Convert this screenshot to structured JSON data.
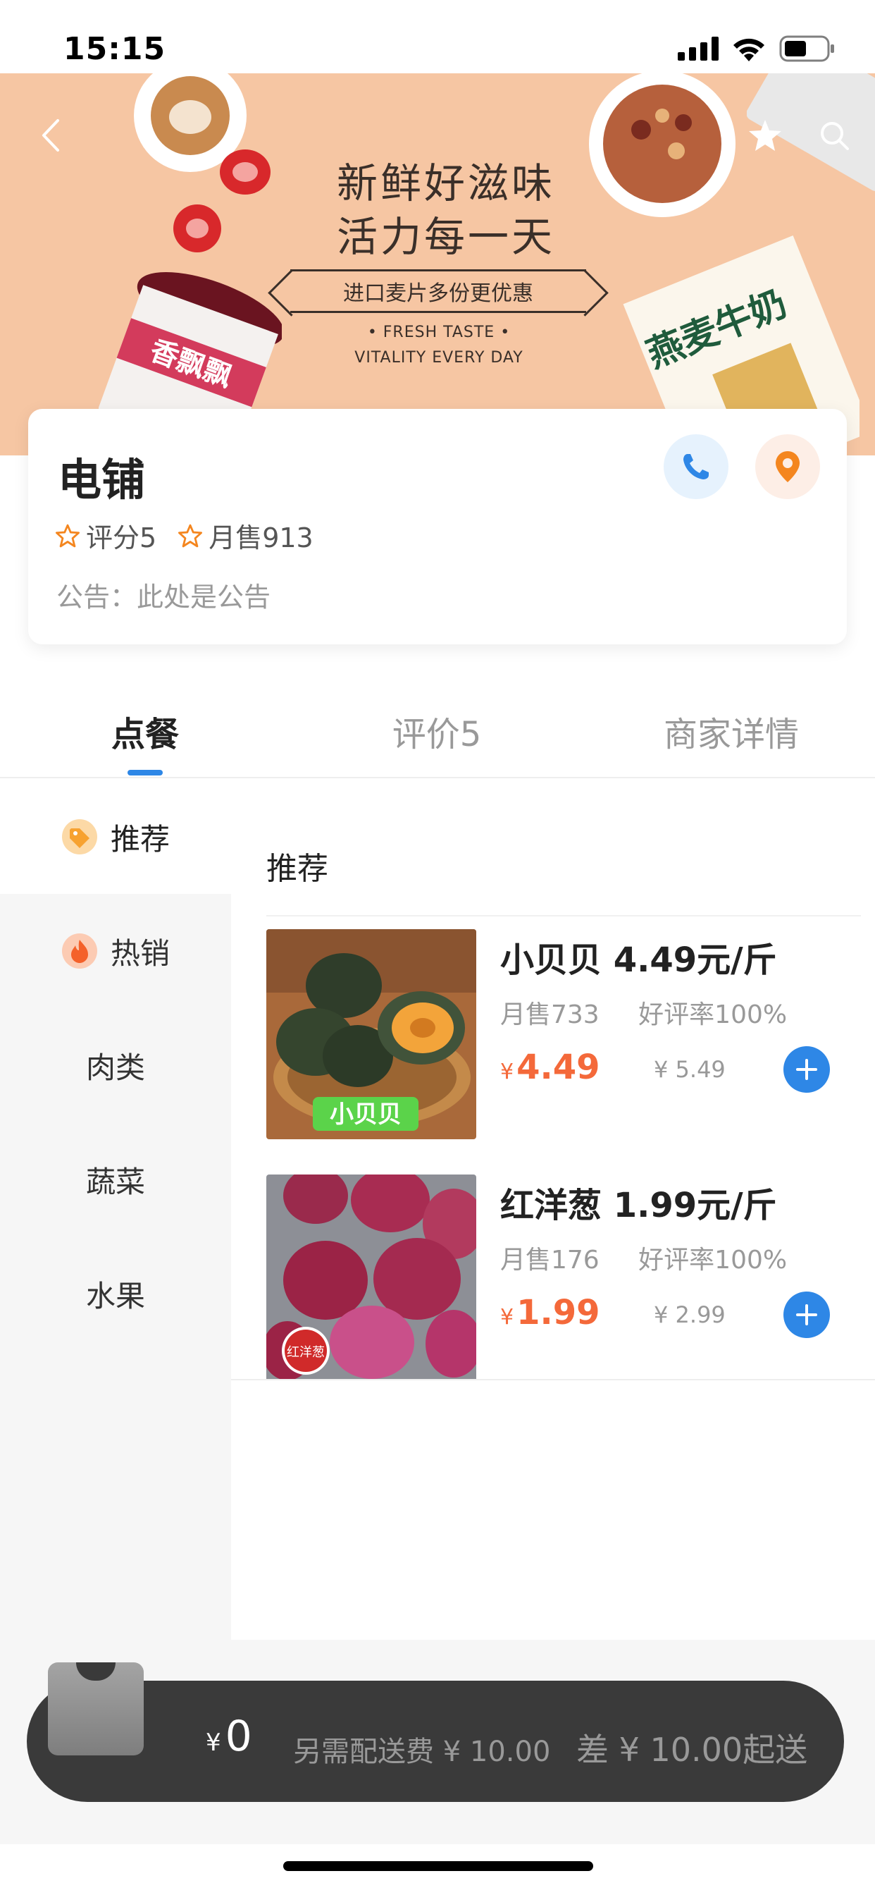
{
  "status_bar": {
    "time": "15:15"
  },
  "banner": {
    "headline_line1": "新鲜好滋味",
    "headline_line2": "活力每一天",
    "ribbon": "进口麦片多份更优惠",
    "sub_line1": "• FRESH TASTE •",
    "sub_line2": "VITALITY EVERY DAY",
    "bg_color": "#f6c6a3"
  },
  "shop": {
    "name": "电铺",
    "rating": "评分5",
    "monthly_sales": "月售913",
    "notice": "公告：此处是公告"
  },
  "tabs": [
    {
      "label": "点餐",
      "active": true
    },
    {
      "label": "评价5",
      "active": false
    },
    {
      "label": "商家详情",
      "active": false
    }
  ],
  "categories": [
    {
      "label": "推荐",
      "icon": "tag-icon",
      "active": true
    },
    {
      "label": "热销",
      "icon": "flame-icon",
      "active": false
    },
    {
      "label": "肉类",
      "active": false
    },
    {
      "label": "蔬菜",
      "active": false
    },
    {
      "label": "水果",
      "active": false
    }
  ],
  "section_title": "推荐",
  "products": [
    {
      "name": "小贝贝 4.49元/斤",
      "monthly_sales": "月售733",
      "rating": "好评率100%",
      "currency": "¥",
      "price": "4.49",
      "original_price": "¥ 5.49",
      "image_label": "小贝贝"
    },
    {
      "name": "红洋葱 1.99元/斤",
      "monthly_sales": "月售176",
      "rating": "好评率100%",
      "currency": "¥",
      "price": "1.99",
      "original_price": "¥ 2.99",
      "image_label": "红洋葱"
    }
  ],
  "cart": {
    "currency": "¥",
    "total": "0",
    "delivery_fee": "另需配送费 ¥ 10.00",
    "min_order": "差 ¥ 10.00起送"
  },
  "colors": {
    "accent_blue": "#2e87e6",
    "price_orange": "#f4693a",
    "cart_bar": "#3a3a3a"
  }
}
